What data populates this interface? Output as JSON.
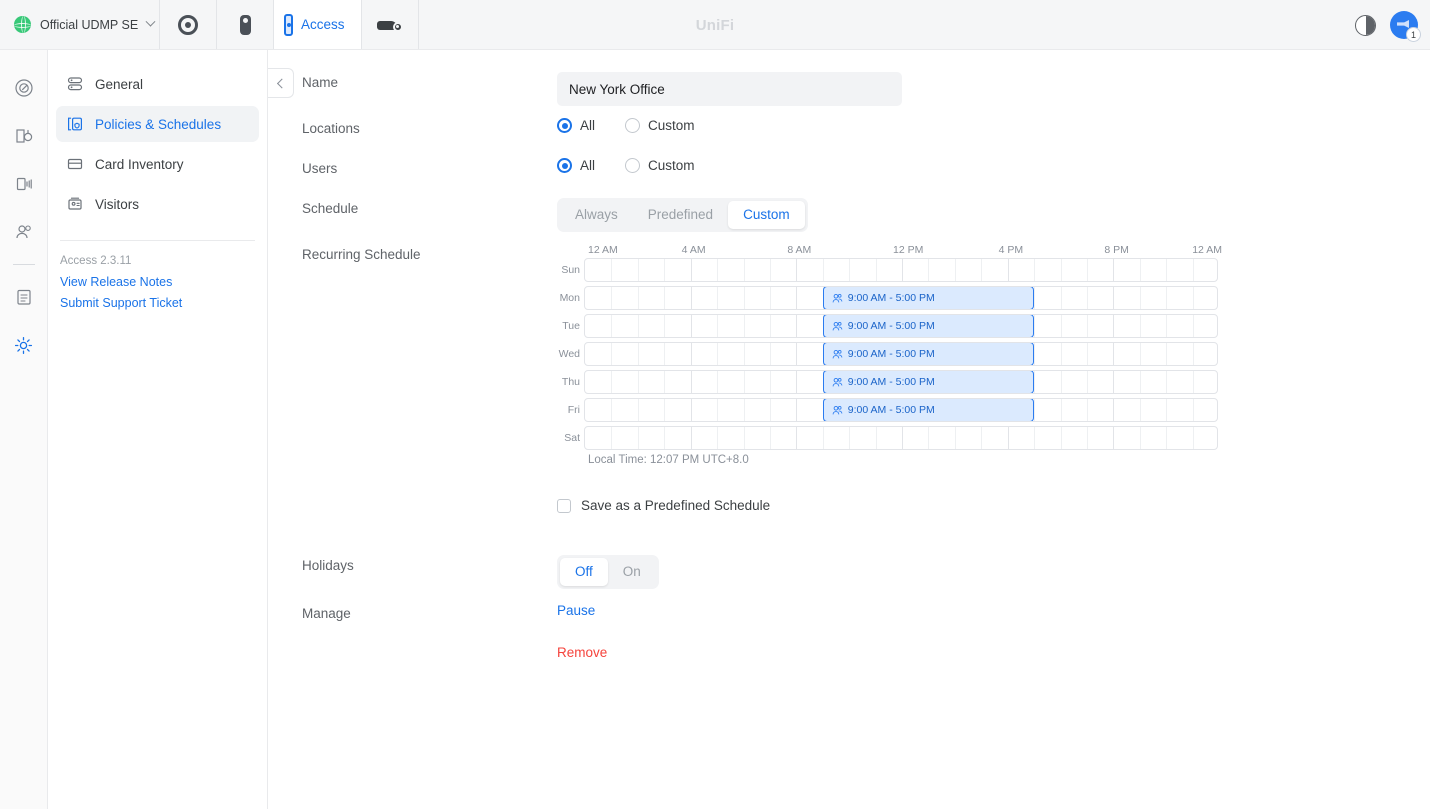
{
  "topbar": {
    "console_name": "Official UDMP SE",
    "brand": "UniFi",
    "apps": [
      {
        "label": "",
        "icon": "protect-icon"
      },
      {
        "label": "",
        "icon": "talk-icon"
      },
      {
        "label": "Access",
        "icon": "access-reader-icon"
      },
      {
        "label": "",
        "icon": "connect-icon"
      }
    ],
    "active_app": "Access",
    "theme_toggle_icon": "contrast-icon",
    "announcements_icon": "megaphone-icon",
    "announcements_badge": "1"
  },
  "rail": {
    "items": [
      {
        "name": "dashboard",
        "icon": "gauge-icon",
        "active": false
      },
      {
        "name": "doors",
        "icon": "door-lock-icon",
        "active": false
      },
      {
        "name": "devices",
        "icon": "reader-signal-icon",
        "active": false
      },
      {
        "name": "users",
        "icon": "users-icon",
        "active": false
      },
      {
        "name": "logs",
        "icon": "clipboard-list-icon",
        "active": false
      },
      {
        "name": "settings",
        "icon": "gear-icon",
        "active": true
      }
    ]
  },
  "subnav": {
    "items": [
      {
        "label": "General",
        "icon": "server-icon",
        "active": false
      },
      {
        "label": "Policies & Schedules",
        "icon": "policy-shield-icon",
        "active": true
      },
      {
        "label": "Card Inventory",
        "icon": "card-icon",
        "active": false
      },
      {
        "label": "Visitors",
        "icon": "visitor-badge-icon",
        "active": false
      }
    ],
    "version": "Access 2.3.11",
    "links": [
      {
        "label": "View Release Notes"
      },
      {
        "label": "Submit Support Ticket"
      }
    ]
  },
  "form": {
    "name": {
      "label": "Name",
      "value": "New York Office",
      "placeholder": "Name"
    },
    "locations": {
      "label": "Locations",
      "options": [
        "All",
        "Custom"
      ],
      "selected": "All"
    },
    "users": {
      "label": "Users",
      "options": [
        "All",
        "Custom"
      ],
      "selected": "All"
    },
    "schedule": {
      "label": "Schedule",
      "options": [
        "Always",
        "Predefined",
        "Custom"
      ],
      "selected": "Custom"
    },
    "recurring": {
      "label": "Recurring Schedule",
      "local_time": "Local Time: 12:07 PM UTC+8.0",
      "save_predefined_label": "Save as a Predefined Schedule",
      "save_predefined_checked": false
    },
    "holidays": {
      "label": "Holidays",
      "options": [
        "Off",
        "On"
      ],
      "selected": "Off"
    },
    "manage": {
      "label": "Manage",
      "pause_label": "Pause",
      "remove_label": "Remove"
    }
  },
  "chart_data": {
    "type": "heatmap",
    "title": "Recurring Schedule",
    "xlabel": "",
    "ylabel": "",
    "axis_ticks": [
      {
        "label": "12 AM",
        "hour": 0
      },
      {
        "label": "4 AM",
        "hour": 4
      },
      {
        "label": "8 AM",
        "hour": 8
      },
      {
        "label": "12 PM",
        "hour": 12
      },
      {
        "label": "4 PM",
        "hour": 16
      },
      {
        "label": "8 PM",
        "hour": 20
      },
      {
        "label": "12 AM",
        "hour": 24
      }
    ],
    "xlim": [
      0,
      24
    ],
    "grid": true,
    "categories": [
      "Sun",
      "Mon",
      "Tue",
      "Wed",
      "Thu",
      "Fri",
      "Sat"
    ],
    "rows": [
      {
        "day": "Sun",
        "blocks": []
      },
      {
        "day": "Mon",
        "blocks": [
          {
            "start_hour": 9,
            "end_hour": 17,
            "label": "9:00 AM - 5:00 PM",
            "icon": "people-icon"
          }
        ]
      },
      {
        "day": "Tue",
        "blocks": [
          {
            "start_hour": 9,
            "end_hour": 17,
            "label": "9:00 AM - 5:00 PM",
            "icon": "people-icon"
          }
        ]
      },
      {
        "day": "Wed",
        "blocks": [
          {
            "start_hour": 9,
            "end_hour": 17,
            "label": "9:00 AM - 5:00 PM",
            "icon": "people-icon"
          }
        ]
      },
      {
        "day": "Thu",
        "blocks": [
          {
            "start_hour": 9,
            "end_hour": 17,
            "label": "9:00 AM - 5:00 PM",
            "icon": "people-icon"
          }
        ]
      },
      {
        "day": "Fri",
        "blocks": [
          {
            "start_hour": 9,
            "end_hour": 17,
            "label": "9:00 AM - 5:00 PM",
            "icon": "people-icon"
          }
        ]
      },
      {
        "day": "Sat",
        "blocks": []
      }
    ],
    "colors": {
      "block_fill": "#dbeafe",
      "block_border": "#2b7cf0",
      "block_text": "#1b64c9"
    }
  },
  "colors": {
    "accent": "#1a73e8",
    "danger": "#f5433c",
    "bg": "#ffffff",
    "panel": "#f5f6f7",
    "muted": "#8a9099"
  }
}
